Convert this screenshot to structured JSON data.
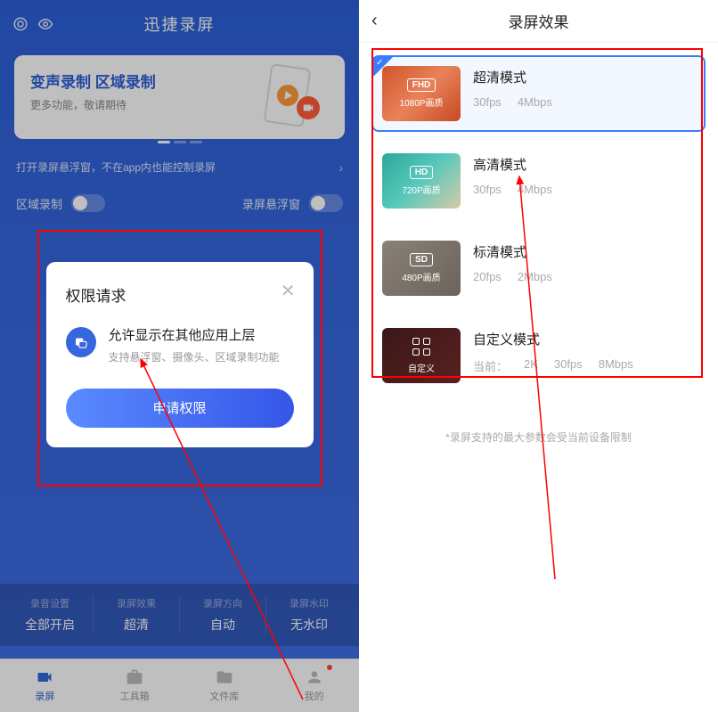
{
  "left": {
    "app_title": "迅捷录屏",
    "banner": {
      "title": "变声录制 区域录制",
      "subtitle": "更多功能，敬请期待"
    },
    "tip": "打开录屏悬浮窗，不在app内也能控制录屏",
    "toggles": {
      "region": "区域录制",
      "float": "录屏悬浮窗"
    },
    "settings": [
      {
        "label": "录音设置",
        "value": "全部开启"
      },
      {
        "label": "录屏效果",
        "value": "超清"
      },
      {
        "label": "录屏方向",
        "value": "自动"
      },
      {
        "label": "录屏水印",
        "value": "无水印"
      }
    ],
    "nav": [
      {
        "label": "录屏",
        "active": true
      },
      {
        "label": "工具箱",
        "active": false
      },
      {
        "label": "文件库",
        "active": false
      },
      {
        "label": "我的",
        "active": false
      }
    ],
    "modal": {
      "title": "权限请求",
      "perm_title": "允许显示在其他应用上层",
      "perm_desc": "支持悬浮窗、摄像头、区域录制功能",
      "button": "申请权限"
    }
  },
  "right": {
    "title": "录屏效果",
    "options": [
      {
        "badge": "FHD",
        "caption": "1080P画质",
        "title": "超清模式",
        "fps": "30fps",
        "bitrate": "4Mbps",
        "selected": true
      },
      {
        "badge": "HD",
        "caption": "720P画质",
        "title": "高清模式",
        "fps": "30fps",
        "bitrate": "4Mbps",
        "selected": false
      },
      {
        "badge": "SD",
        "caption": "480P画质",
        "title": "标清模式",
        "fps": "20fps",
        "bitrate": "2Mbps",
        "selected": false
      },
      {
        "badge": "",
        "caption": "自定义",
        "title": "自定义模式",
        "current": "当前：",
        "res": "2K",
        "fps": "30fps",
        "bitrate": "8Mbps",
        "selected": false
      }
    ],
    "footer": "*录屏支持的最大参数会受当前设备限制"
  }
}
